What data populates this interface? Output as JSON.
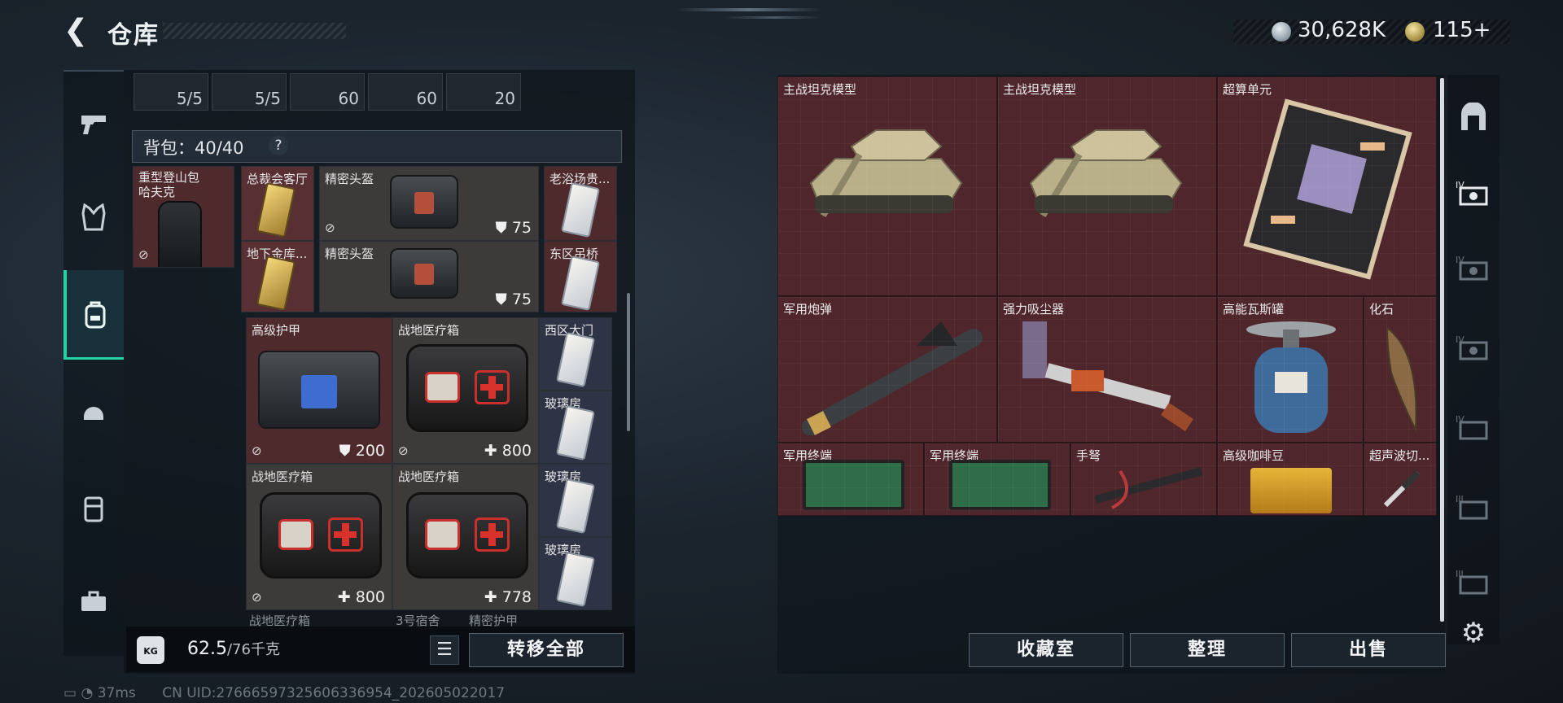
{
  "header": {
    "title": "仓库",
    "currency": [
      {
        "icon": "silver-coin-icon",
        "value": "30,628K"
      },
      {
        "icon": "gold-coin-icon",
        "value": "115+"
      }
    ]
  },
  "left_nav": [
    "pistol-icon",
    "armor-vest-icon",
    "backpack-icon",
    "helmet-icon",
    "chest-rig-icon",
    "toolbox-icon"
  ],
  "top_slots": [
    "5/5",
    "5/5",
    "60",
    "60",
    "20"
  ],
  "backpack": {
    "label": "背包：",
    "capacity": "40/40",
    "help": "?"
  },
  "left_items": [
    {
      "name": "重型登山包",
      "name2": "哈夫克",
      "color": "red"
    },
    {
      "name": "总裁会客厅",
      "color": "red2"
    },
    {
      "name": "地下金库...",
      "color": "red2"
    },
    {
      "name": "精密头盔",
      "value": "75",
      "color": "grey"
    },
    {
      "name": "精密头盔",
      "value": "75",
      "color": "grey"
    },
    {
      "name": "老浴场贵...",
      "color": "red"
    },
    {
      "name": "东区吊桥",
      "color": "red"
    },
    {
      "name": "高级护甲",
      "value": "200",
      "color": "red"
    },
    {
      "name": "战地医疗箱",
      "value": "800",
      "color": "grey"
    },
    {
      "name": "西区大门",
      "color": "blue"
    },
    {
      "name": "玻璃房",
      "color": "blue"
    },
    {
      "name": "战地医疗箱",
      "value": "800",
      "color": "grey"
    },
    {
      "name": "战地医疗箱",
      "value": "778",
      "color": "grey"
    },
    {
      "name": "玻璃房",
      "color": "blue"
    },
    {
      "name": "玻璃房",
      "color": "blue"
    }
  ],
  "partial_row": [
    "战地医疗箱",
    "3号宿舍",
    "精密护甲"
  ],
  "left_footer": {
    "weight_icon_text": "KG",
    "weight": "62.5",
    "weight_max": "/76千克",
    "transfer_all": "转移全部"
  },
  "right_items": [
    {
      "name": "主战坦克模型"
    },
    {
      "name": "主战坦克模型"
    },
    {
      "name": "超算单元"
    },
    {
      "name": "军用炮弹"
    },
    {
      "name": "强力吸尘器"
    },
    {
      "name": "高能瓦斯罐"
    },
    {
      "name": "化石"
    },
    {
      "name": "军用终端"
    },
    {
      "name": "军用终端"
    },
    {
      "name": "手弩"
    },
    {
      "name": "高级咖啡豆"
    },
    {
      "name": "超声波切..."
    }
  ],
  "right_footer": {
    "collection": "收藏室",
    "organize": "整理",
    "sell": "出售"
  },
  "right_nav": [
    "vault-icon",
    "storage-IV-icon",
    "storage-IV-icon",
    "storage-IV-icon",
    "storage-IV-icon",
    "storage-III-icon",
    "storage-III-icon",
    "settings-icon"
  ],
  "status": {
    "ping": "37ms",
    "uid": "CN UID:27666597325606336954_202605022017"
  },
  "colors": {
    "accent": "#26d3a4",
    "item_red": "#4f262b"
  }
}
